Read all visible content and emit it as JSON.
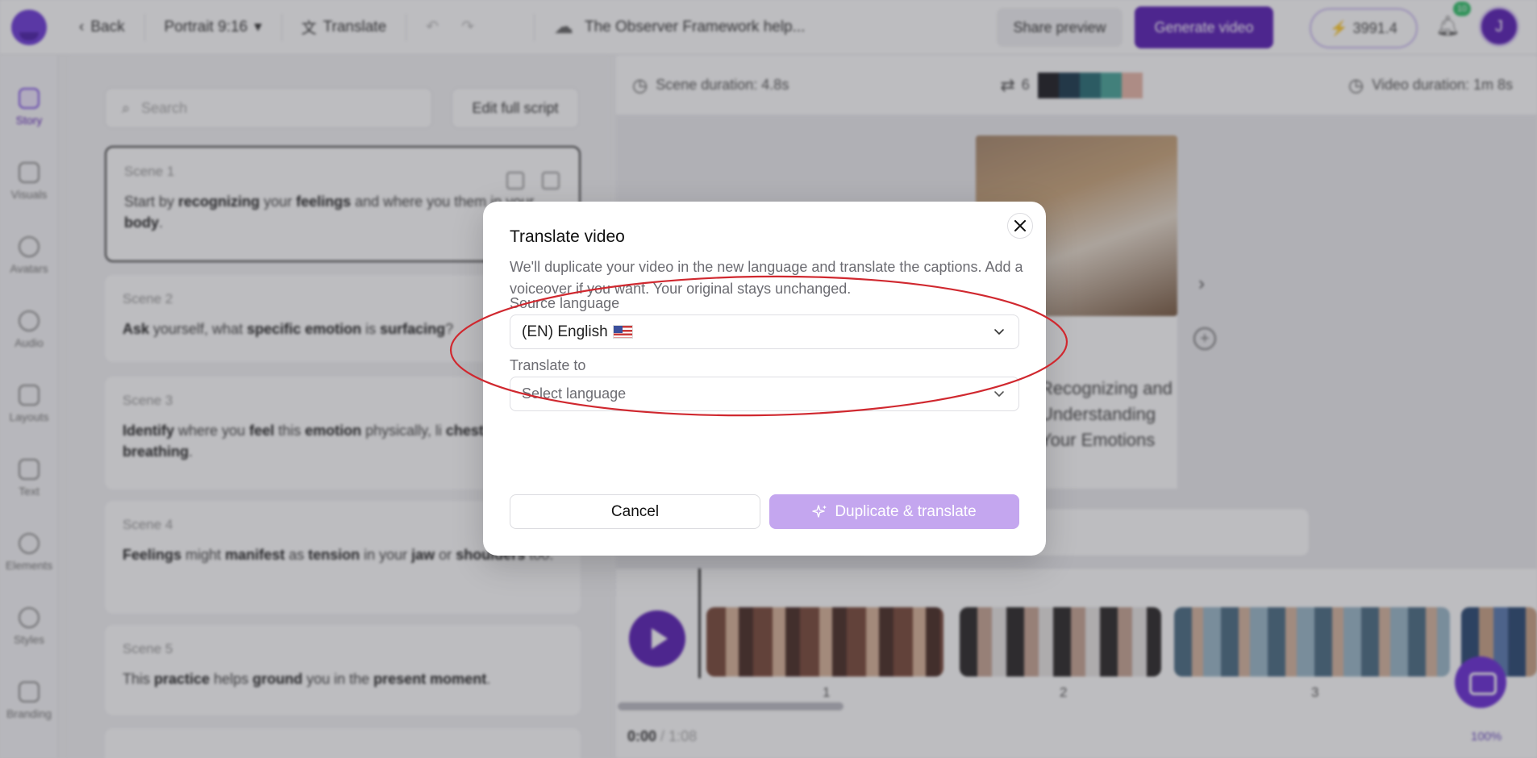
{
  "topbar": {
    "back_label": "Back",
    "aspect_label": "Portrait 9:16",
    "translate_label": "Translate",
    "project_title": "The Observer Framework help...",
    "share_label": "Share preview",
    "generate_label": "Generate video",
    "credits": "3991.4",
    "notification_count": "10",
    "avatar_initial": "J"
  },
  "sidebar": {
    "items": [
      {
        "label": "Story",
        "icon": "story-icon",
        "active": true
      },
      {
        "label": "Visuals",
        "icon": "image-icon"
      },
      {
        "label": "Avatars",
        "icon": "avatar-icon"
      },
      {
        "label": "Audio",
        "icon": "audio-icon"
      },
      {
        "label": "Layouts",
        "icon": "layout-icon"
      },
      {
        "label": "Text",
        "icon": "text-icon"
      },
      {
        "label": "Elements",
        "icon": "elements-icon"
      },
      {
        "label": "Styles",
        "icon": "styles-icon"
      },
      {
        "label": "Branding",
        "icon": "branding-icon"
      }
    ]
  },
  "script_panel": {
    "search_placeholder": "Search",
    "edit_script_label": "Edit full script",
    "scenes": [
      {
        "label": "Scene 1",
        "parts": [
          [
            "Start by ",
            false
          ],
          [
            "recognizing",
            true
          ],
          [
            " your ",
            false
          ],
          [
            "feelings",
            true
          ],
          [
            " and where you",
            false
          ],
          [
            " them in your ",
            false
          ],
          [
            "body",
            true
          ],
          [
            ".",
            false
          ]
        ]
      },
      {
        "label": "Scene 2",
        "parts": [
          [
            "Ask",
            true
          ],
          [
            " yourself, what ",
            false
          ],
          [
            "specific emotion",
            true
          ],
          [
            " is ",
            false
          ],
          [
            "surfacing",
            true
          ],
          [
            "?",
            false
          ]
        ]
      },
      {
        "label": "Scene 3",
        "parts": [
          [
            "Identify",
            true
          ],
          [
            " where you ",
            false
          ],
          [
            "feel",
            true
          ],
          [
            " this ",
            false
          ],
          [
            "emotion",
            true
          ],
          [
            " physically, li",
            false
          ],
          [
            " chest",
            true
          ],
          [
            " or ",
            false
          ],
          [
            "shallow breathing",
            true
          ],
          [
            ".",
            false
          ]
        ]
      },
      {
        "label": "Scene 4",
        "parts": [
          [
            "Feelings",
            true
          ],
          [
            " might ",
            false
          ],
          [
            "manifest",
            true
          ],
          [
            " as ",
            false
          ],
          [
            "tension",
            true
          ],
          [
            " in your ",
            false
          ],
          [
            "jaw",
            true
          ],
          [
            " or ",
            false
          ],
          [
            "shoulders",
            true
          ],
          [
            " too.",
            false
          ]
        ]
      },
      {
        "label": "Scene 5",
        "parts": [
          [
            "This ",
            false
          ],
          [
            "practice",
            true
          ],
          [
            " helps ",
            false
          ],
          [
            "ground",
            true
          ],
          [
            " you in the ",
            false
          ],
          [
            "present moment",
            true
          ],
          [
            ".",
            false
          ]
        ]
      }
    ]
  },
  "stage": {
    "scene_duration": "Scene duration: 4.8s",
    "shuffle_count": "6",
    "video_duration": "Video duration: 1m 8s",
    "swatch_colors": [
      "#1f1f24",
      "#1d3b4f",
      "#2a6f77",
      "#4aa59a",
      "#e8b7a8"
    ],
    "preview_text": "Recognizing and Understanding Your Emotions"
  },
  "timeline": {
    "clip_numbers": [
      "1",
      "2",
      "3"
    ],
    "current_time": "0:00",
    "total_time": "1:08",
    "zoom": "100%"
  },
  "modal": {
    "title": "Translate video",
    "description": "We'll duplicate your video in the new language and translate the captions. Add a voiceover if you want. Your original stays unchanged.",
    "source_label": "Source language",
    "source_value": "(EN) English",
    "source_flag": "us-flag",
    "target_label": "Translate to",
    "target_placeholder": "Select language",
    "cancel_label": "Cancel",
    "confirm_label": "Duplicate & translate",
    "colors": {
      "confirm_disabled": "#c4a6ef",
      "accent": "#5b21b6",
      "annotation": "#d0282f"
    }
  }
}
